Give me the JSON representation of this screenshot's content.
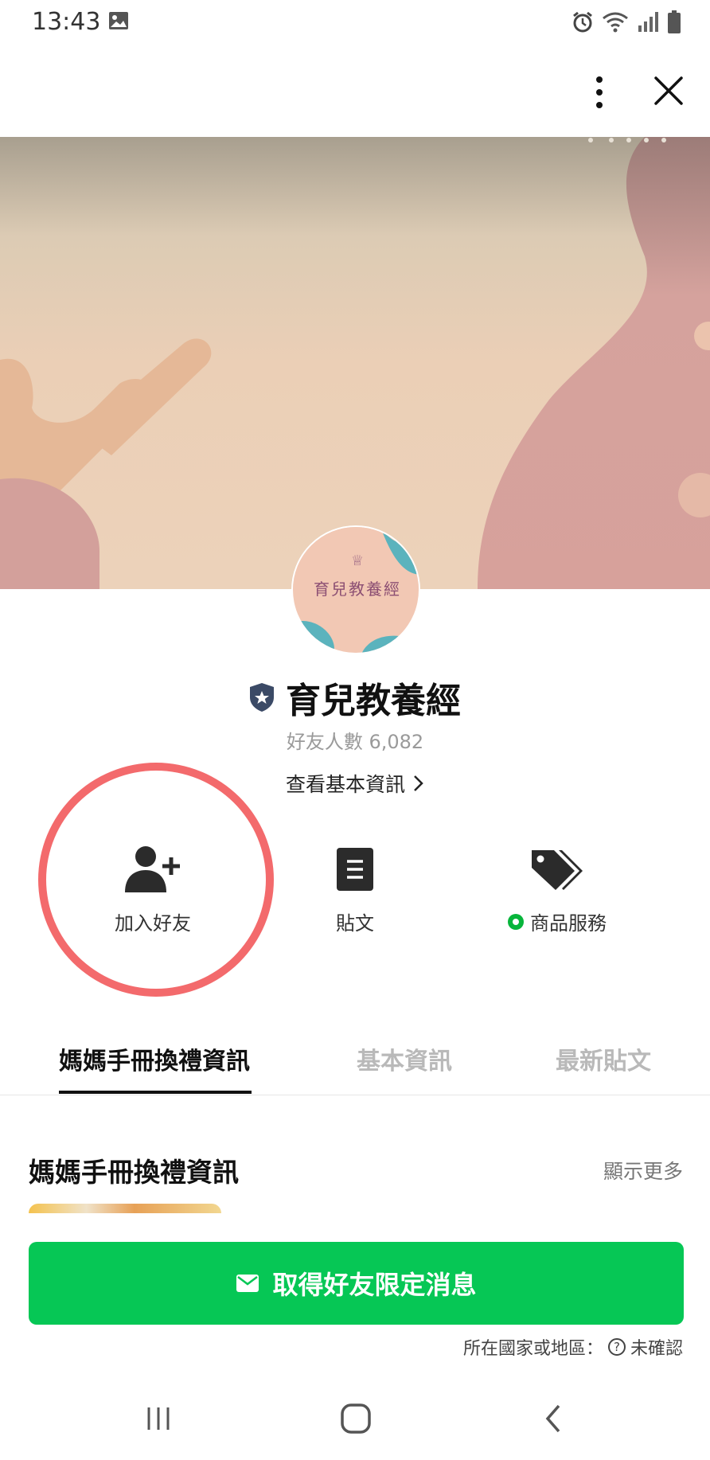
{
  "status_bar": {
    "time": "13:43",
    "icons": [
      "image-icon",
      "alarm-icon",
      "wifi-icon",
      "signal-icon",
      "battery-icon"
    ]
  },
  "top_bar": {
    "icons": [
      "more-vertical-icon",
      "close-icon"
    ]
  },
  "account": {
    "name": "育兒教養經",
    "friend_count": "好友人數 6,082",
    "basic_info_link": "查看基本資訊",
    "avatar_text": "育兒教養經",
    "badge_icon": "verified-shield-icon"
  },
  "actions": [
    {
      "label": "加入好友",
      "icon": "add-friend-icon"
    },
    {
      "label": "貼文",
      "icon": "post-icon"
    },
    {
      "label": "商品服務",
      "icon": "tag-icon"
    }
  ],
  "tabs": [
    {
      "label": "媽媽手冊換禮資訊",
      "active": true
    },
    {
      "label": "基本資訊",
      "active": false
    },
    {
      "label": "最新貼文",
      "active": false
    }
  ],
  "section": {
    "title": "媽媽手冊換禮資訊",
    "show_more": "顯示更多"
  },
  "cta": {
    "label": "取得好友限定消息",
    "icon": "mail-icon"
  },
  "region": {
    "label": "所在國家或地區：",
    "value": "未確認",
    "icon": "question-icon"
  },
  "nav": [
    "recent-apps-icon",
    "home-icon",
    "back-icon"
  ],
  "colors": {
    "line_green": "#06c755",
    "highlight_red": "#f36a6c",
    "inactive_tab": "#b9b9b9"
  }
}
